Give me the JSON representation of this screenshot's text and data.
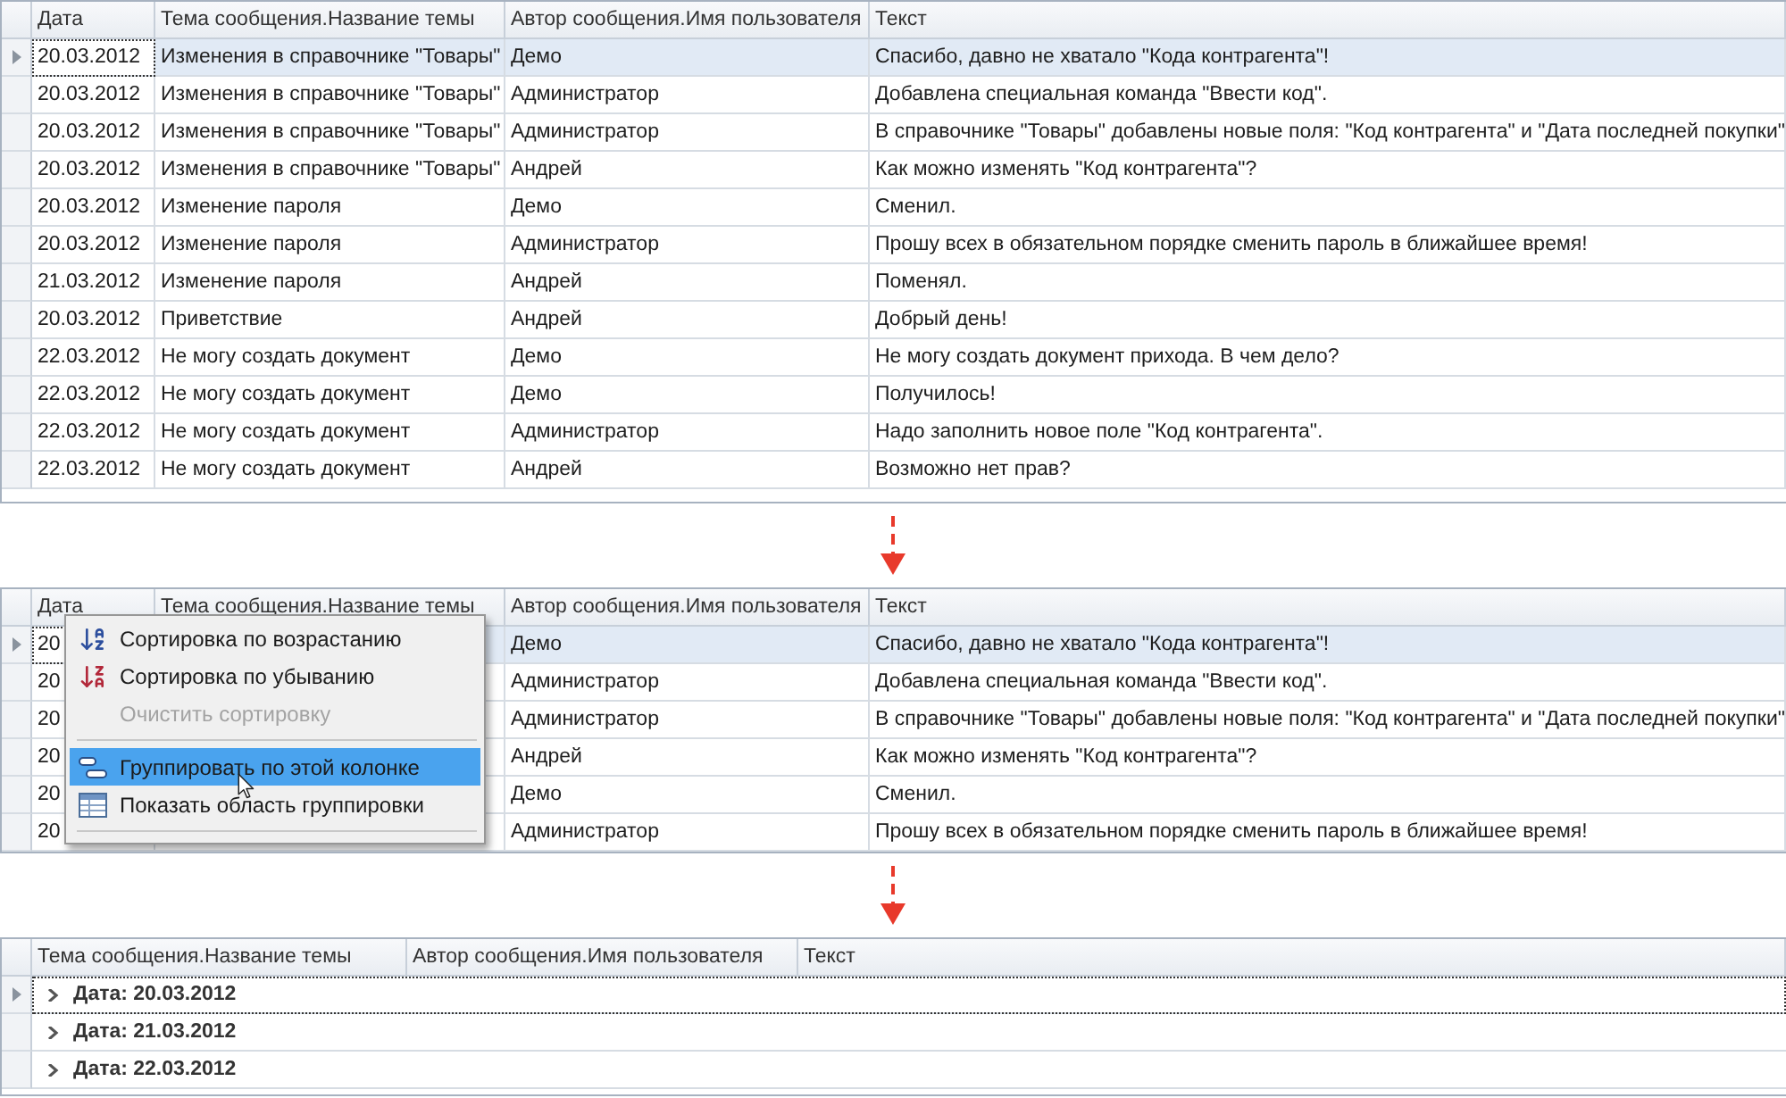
{
  "grids": [
    {
      "kind": "flat",
      "columns": [
        "Дата",
        "Тема сообщения.Название темы",
        "Автор сообщения.Имя пользователя",
        "Текст"
      ],
      "rows": [
        {
          "selected": true,
          "cells": [
            "20.03.2012",
            "Изменения в справочнике \"Товары\"",
            "Демо",
            "Спасибо, давно не хватало \"Кода контрагента\"!"
          ]
        },
        {
          "selected": false,
          "cells": [
            "20.03.2012",
            "Изменения в справочнике \"Товары\"",
            "Администратор",
            "Добавлена специальная команда \"Ввести код\"."
          ]
        },
        {
          "selected": false,
          "cells": [
            "20.03.2012",
            "Изменения в справочнике \"Товары\"",
            "Администратор",
            "В справочнике \"Товары\" добавлены новые поля: \"Код контрагента\" и \"Дата последней покупки\""
          ]
        },
        {
          "selected": false,
          "cells": [
            "20.03.2012",
            "Изменения в справочнике \"Товары\"",
            "Андрей",
            "Как можно изменять \"Код контрагента\"?"
          ]
        },
        {
          "selected": false,
          "cells": [
            "20.03.2012",
            "Изменение пароля",
            "Демо",
            "Сменил."
          ]
        },
        {
          "selected": false,
          "cells": [
            "20.03.2012",
            "Изменение пароля",
            "Администратор",
            "Прошу всех в обязательном порядке сменить пароль в ближайшее время!"
          ]
        },
        {
          "selected": false,
          "cells": [
            "21.03.2012",
            "Изменение пароля",
            "Андрей",
            "Поменял."
          ]
        },
        {
          "selected": false,
          "cells": [
            "20.03.2012",
            "Приветствие",
            "Андрей",
            "Добрый день!"
          ]
        },
        {
          "selected": false,
          "cells": [
            "22.03.2012",
            "Не могу создать документ",
            "Демо",
            "Не могу создать документ прихода. В чем дело?"
          ]
        },
        {
          "selected": false,
          "cells": [
            "22.03.2012",
            "Не могу создать документ",
            "Демо",
            "Получилось!"
          ]
        },
        {
          "selected": false,
          "cells": [
            "22.03.2012",
            "Не могу создать документ",
            "Администратор",
            "Надо заполнить новое поле \"Код контрагента\"."
          ]
        },
        {
          "selected": false,
          "cells": [
            "22.03.2012",
            "Не могу создать документ",
            "Андрей",
            "Возможно нет прав?"
          ]
        }
      ]
    },
    {
      "kind": "flat",
      "columns": [
        "Дата",
        "Тема сообщения.Название темы",
        "Автор сообщения.Имя пользователя",
        "Текст"
      ],
      "rows": [
        {
          "selected": true,
          "cells": [
            "20",
            "",
            "Демо",
            "Спасибо, давно не хватало \"Кода контрагента\"!"
          ]
        },
        {
          "selected": false,
          "cells": [
            "20",
            "",
            "Администратор",
            "Добавлена специальная команда \"Ввести код\"."
          ]
        },
        {
          "selected": false,
          "cells": [
            "20",
            "",
            "Администратор",
            "В справочнике \"Товары\" добавлены новые поля: \"Код контрагента\" и \"Дата последней покупки\""
          ]
        },
        {
          "selected": false,
          "cells": [
            "20",
            "",
            "Андрей",
            "Как можно изменять \"Код контрагента\"?"
          ]
        },
        {
          "selected": false,
          "cells": [
            "20",
            "",
            "Демо",
            "Сменил."
          ]
        },
        {
          "selected": false,
          "cells": [
            "20",
            "",
            "Администратор",
            "Прошу всех в обязательном порядке сменить пароль в ближайшее время!"
          ]
        }
      ],
      "context_menu": {
        "items": [
          {
            "kind": "sort-asc",
            "label": "Сортировка по возрастанию",
            "disabled": false,
            "selected": false
          },
          {
            "kind": "sort-desc",
            "label": "Сортировка по убыванию",
            "disabled": false,
            "selected": false
          },
          {
            "kind": "plain",
            "label": "Очистить сортировку",
            "disabled": true,
            "selected": false
          },
          {
            "kind": "separator"
          },
          {
            "kind": "group",
            "label": "Группировать по этой колонке",
            "disabled": false,
            "selected": true
          },
          {
            "kind": "group-area",
            "label": "Показать область группировки",
            "disabled": false,
            "selected": false
          },
          {
            "kind": "separator"
          }
        ]
      }
    },
    {
      "kind": "grouped",
      "columns": [
        "Тема сообщения.Название темы",
        "Автор сообщения.Имя пользователя",
        "Текст"
      ],
      "groups": [
        {
          "label": "Дата: 20.03.2012",
          "selected": true,
          "expanded": false
        },
        {
          "label": "Дата: 21.03.2012",
          "selected": false,
          "expanded": false
        },
        {
          "label": "Дата: 22.03.2012",
          "selected": false,
          "expanded": false
        }
      ]
    }
  ]
}
